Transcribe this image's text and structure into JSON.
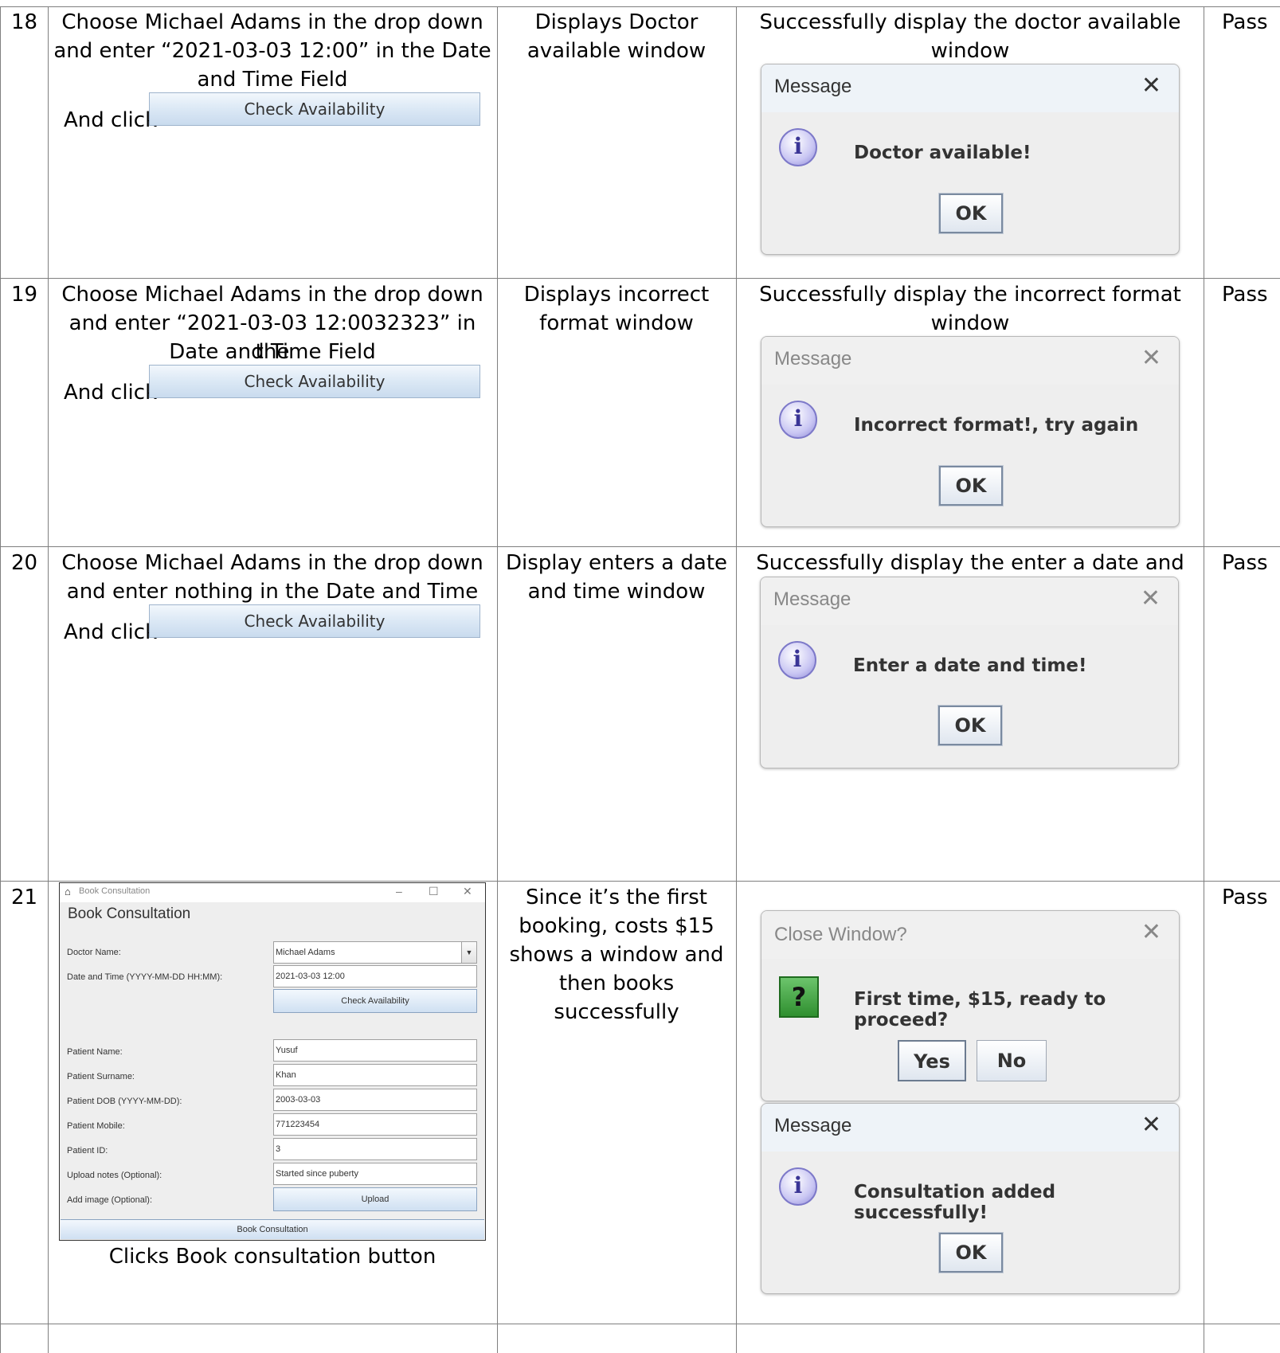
{
  "rows": [
    {
      "num": "18",
      "steps_line1": "Choose Michael Adams in the drop down",
      "steps_line2": "and enter “2021-03-03 12:00” in the Date",
      "steps_line3": "and Time Field",
      "and_click": "And click",
      "button": "Check Availability",
      "expected_line1": "Displays Doctor",
      "expected_line2": "available window",
      "actual_line1": "Successfully display the doctor available",
      "actual_line2": "window",
      "dialog_title": "Message",
      "dialog_message": "Doctor available!",
      "dialog_ok": "OK",
      "result": "Pass"
    },
    {
      "num": "19",
      "steps_line1": "Choose Michael Adams in the drop down",
      "steps_line2": "and enter “2021-03-03 12:0032323” in the",
      "steps_line3": "Date and Time Field",
      "and_click": "And click",
      "button": "Check Availability",
      "expected_line1": "Displays incorrect",
      "expected_line2": "format window",
      "actual_line1": "Successfully display the incorrect format",
      "actual_line2": "window",
      "dialog_title": "Message",
      "dialog_message": "Incorrect format!, try again",
      "dialog_ok": "OK",
      "result": "Pass"
    },
    {
      "num": "20",
      "steps_line1": "Choose Michael Adams in the drop down",
      "steps_line2": "and enter nothing in the Date and Time Field",
      "and_click": "And click",
      "button": "Check Availability",
      "expected_line1": "Display enters a date",
      "expected_line2": "and time window",
      "actual_line1": "Successfully display the enter a date and time",
      "dialog_title": "Message",
      "dialog_message": "Enter a date and time!",
      "dialog_ok": "OK",
      "result": "Pass"
    },
    {
      "num": "21",
      "window": {
        "title_small": "Book Consultation",
        "heading": "Book Consultation",
        "fields": [
          {
            "label": "Doctor Name:",
            "value": "Michael Adams"
          },
          {
            "label": "Date and Time (YYYY-MM-DD HH:MM):",
            "value": "2021-03-03 12:00"
          },
          {
            "label": "Patient Name:",
            "value": "Yusuf"
          },
          {
            "label": "Patient Surname:",
            "value": "Khan"
          },
          {
            "label": "Patient DOB (YYYY-MM-DD):",
            "value": "2003-03-03"
          },
          {
            "label": "Patient Mobile:",
            "value": "771223454"
          },
          {
            "label": "Patient ID:",
            "value": "3"
          },
          {
            "label": "Upload notes (Optional):",
            "value": "Started since puberty"
          },
          {
            "label": "Add image (Optional):",
            "value": ""
          }
        ],
        "check_button": "Check Availability",
        "upload_button": "Upload",
        "book_button": "Book Consultation",
        "minimize": "–",
        "maximize": "☐",
        "close": "✕"
      },
      "caption": "Clicks Book consultation button",
      "expected_lines": [
        "Since it’s the first",
        "booking, costs $15",
        "shows a window and",
        "then books",
        "successfully"
      ],
      "confirm_title": "Close Window?",
      "confirm_message": "First time, $15, ready to proceed?",
      "yes": "Yes",
      "no": "No",
      "dialog_title": "Message",
      "dialog_message": "Consultation added successfully!",
      "dialog_ok": "OK",
      "result": "Pass"
    }
  ],
  "icons": {
    "info": "info-icon",
    "question": "question-icon",
    "close": "close-icon",
    "home": "home-icon",
    "dropdown": "chevron-down-icon"
  }
}
